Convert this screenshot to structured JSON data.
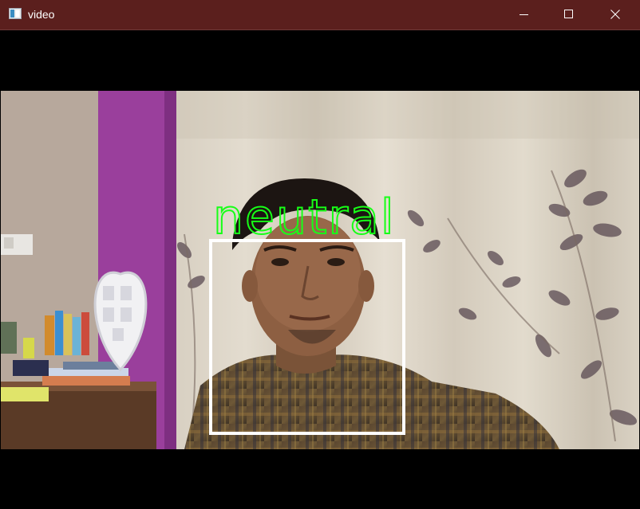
{
  "window": {
    "title": "video",
    "titlebar_color": "#5b1f1d",
    "controls": {
      "minimize_icon": "minimize-icon",
      "maximize_icon": "maximize-icon",
      "close_icon": "close-icon"
    }
  },
  "video": {
    "emotion_label": "neutral",
    "label_color": "#17ff17",
    "box_color": "#ffffff"
  }
}
